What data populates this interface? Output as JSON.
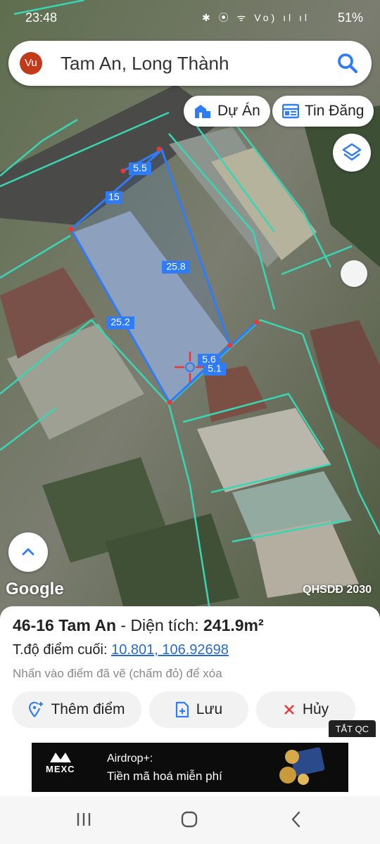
{
  "status_bar": {
    "time": "23:48",
    "battery": "51%",
    "icons": "✱ ⦿ ᯤ Vo) ıl ıl"
  },
  "search": {
    "avatar": "Vu",
    "query": "Tam An, Long Thành"
  },
  "chips": [
    {
      "label": "Dự Án",
      "icon": "building-icon"
    },
    {
      "label": "Tin Đăng",
      "icon": "list-icon"
    }
  ],
  "map": {
    "edge_labels": [
      "5.5",
      "15",
      "25.8",
      "25.2",
      "5.6",
      "5.1"
    ],
    "attribution": "Google",
    "overlay_badge": "QHSDĐ 2030",
    "colors": {
      "parcel_outline": "#2f7cf6",
      "lot_lines": "#39d6b4",
      "vertex": "#e53935"
    }
  },
  "info": {
    "parcel_name": "46-16 Tam An",
    "area_label": " - Diện tích: ",
    "area_value": "241.9m²",
    "coord_label": "T.độ điểm cuối: ",
    "coord_value": "10.801, 106.92698",
    "hint": "Nhấn vào điểm đã vẽ (chấm đỏ) để xóa"
  },
  "actions": [
    {
      "label": "Thêm điểm",
      "icon": "add-location-icon"
    },
    {
      "label": "Lưu",
      "icon": "save-file-icon"
    },
    {
      "label": "Hủy",
      "icon": "close-icon"
    }
  ],
  "ad": {
    "close_label": "TẮT QC",
    "brand": "MEXC",
    "title": "Airdrop+:",
    "subtitle": "Tiền mã hoá miễn phí"
  }
}
